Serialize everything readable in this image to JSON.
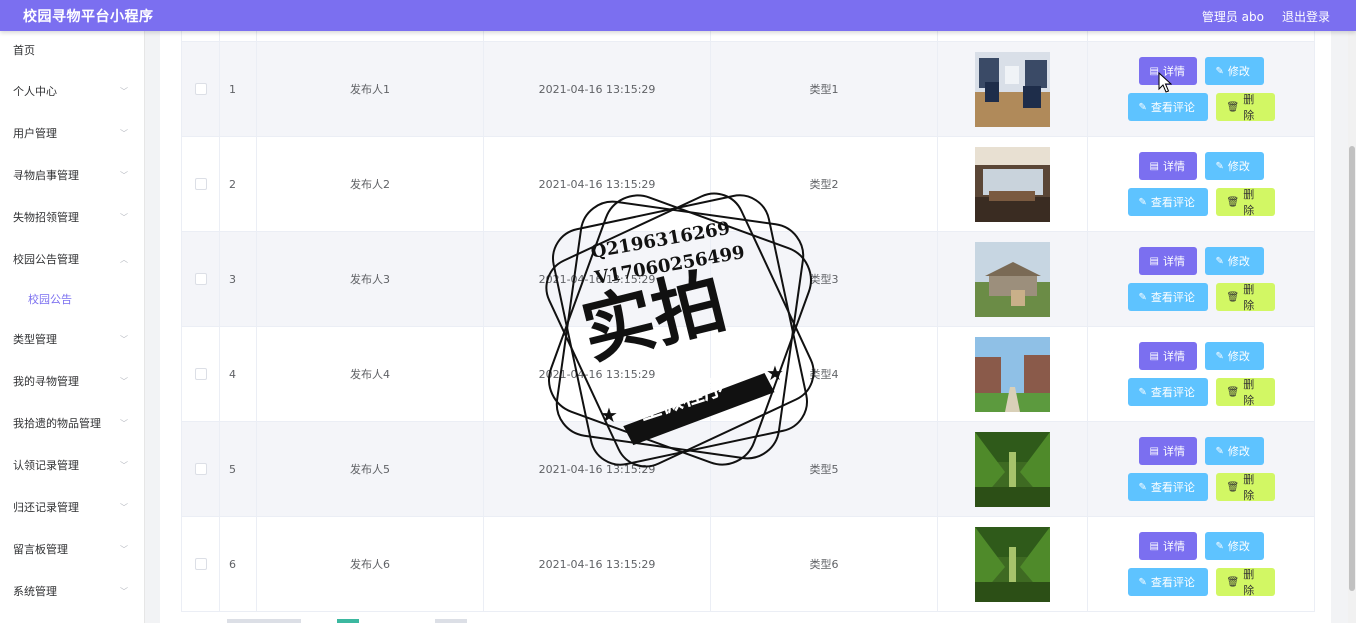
{
  "app": {
    "title": "校园寻物平台小程序",
    "user_label": "管理员 abo",
    "logout": "退出登录"
  },
  "sidebar": {
    "items": [
      {
        "label": "首页",
        "chev": ""
      },
      {
        "label": "个人中心",
        "chev": "﹀"
      },
      {
        "label": "用户管理",
        "chev": "﹀"
      },
      {
        "label": "寻物启事管理",
        "chev": "﹀"
      },
      {
        "label": "失物招领管理",
        "chev": "﹀"
      },
      {
        "label": "校园公告管理",
        "chev": "︿"
      },
      {
        "label": "校园公告",
        "chev": ""
      },
      {
        "label": "类型管理",
        "chev": "﹀"
      },
      {
        "label": "我的寻物管理",
        "chev": "﹀"
      },
      {
        "label": "我拾遗的物品管理",
        "chev": "﹀"
      },
      {
        "label": "认领记录管理",
        "chev": "﹀"
      },
      {
        "label": "归还记录管理",
        "chev": "﹀"
      },
      {
        "label": "留言板管理",
        "chev": "﹀"
      },
      {
        "label": "系统管理",
        "chev": "﹀"
      }
    ]
  },
  "table": {
    "rows": [
      {
        "idx": "1",
        "publisher": "发布人1",
        "time": "2021-04-16 13:15:29",
        "type": "类型1",
        "img": "dorm"
      },
      {
        "idx": "2",
        "publisher": "发布人2",
        "time": "2021-04-16 13:15:29",
        "type": "类型2",
        "img": "office"
      },
      {
        "idx": "3",
        "publisher": "发布人3",
        "time": "2021-04-16 13:15:29",
        "type": "类型3",
        "img": "pavilion"
      },
      {
        "idx": "4",
        "publisher": "发布人4",
        "time": "2021-04-16 13:15:29",
        "type": "类型4",
        "img": "campus"
      },
      {
        "idx": "5",
        "publisher": "发布人5",
        "time": "2021-04-16 13:15:29",
        "type": "类型5",
        "img": "trees"
      },
      {
        "idx": "6",
        "publisher": "发布人6",
        "time": "2021-04-16 13:15:29",
        "type": "类型6",
        "img": "trees"
      }
    ],
    "buttons": {
      "detail": "详情",
      "edit": "修改",
      "comments": "查看评论",
      "delete": "删除"
    }
  },
  "watermark": {
    "line1": "Q2196316269",
    "line2": "V17060256499",
    "main": "实拍",
    "banner": "全微程序"
  },
  "colors": {
    "primary": "#7b6ff0",
    "info": "#5ec3ff",
    "warning": "#d2f764"
  }
}
